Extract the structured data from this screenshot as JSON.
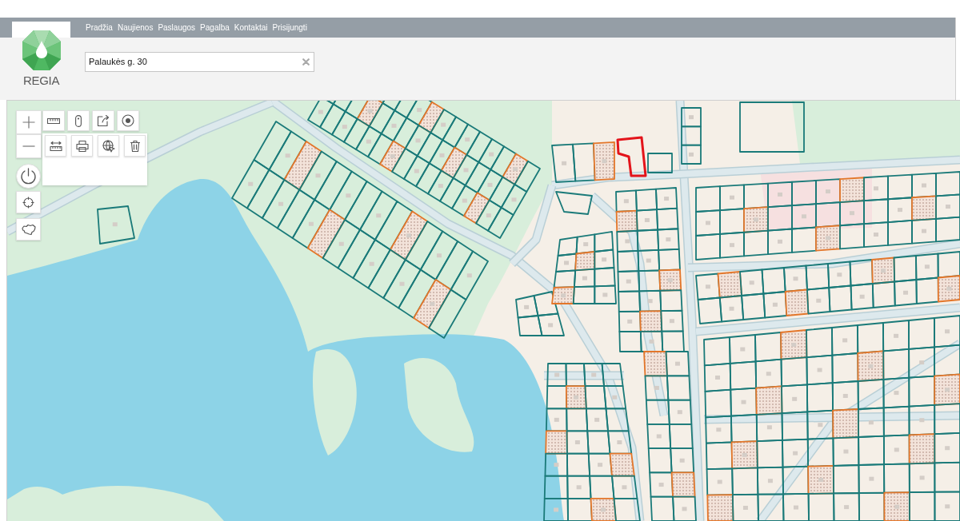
{
  "logo": {
    "text": "REGIA"
  },
  "nav": {
    "items": [
      "Pradžia",
      "Naujienos",
      "Paslaugos",
      "Pagalba",
      "Kontaktai",
      "Prisijungti"
    ]
  },
  "search": {
    "value": "Palaukės g. 30"
  }
}
